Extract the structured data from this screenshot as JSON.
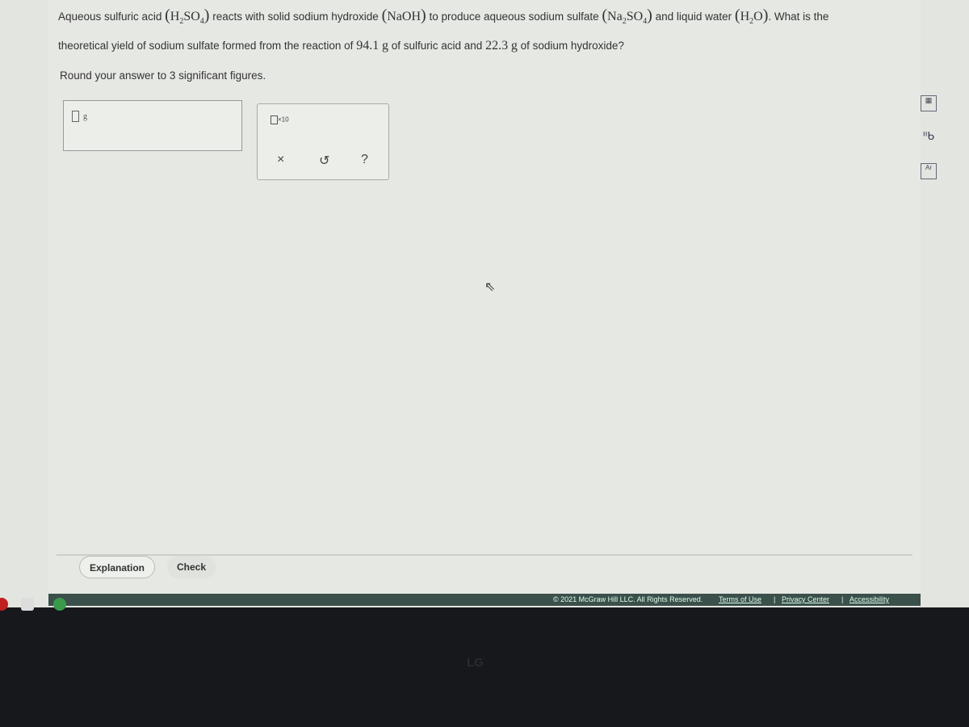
{
  "question": {
    "line1_a": "Aqueous sulfuric acid",
    "h2so4": "H₂SO₄",
    "line1_b": "reacts with solid sodium hydroxide",
    "naoh": "NaOH",
    "line1_c": "to produce aqueous sodium sulfate",
    "na2so4": "Na₂SO₄",
    "line1_d": "and liquid water",
    "h2o": "H₂O",
    "line1_e": ". What is the",
    "line2_a": "theoretical yield of sodium sulfate formed from the reaction of",
    "mass1": "94.1",
    "unit1": "g",
    "line2_b": "of sulfuric acid and",
    "mass2": "22.3",
    "unit2": "g",
    "line2_c": "of sodium hydroxide?",
    "instruction": "Round your answer to 3 significant figures."
  },
  "answer": {
    "value": "",
    "unit": "g"
  },
  "palette": {
    "sci_notation": "×10",
    "clear": "×",
    "undo": "↺",
    "help": "?"
  },
  "buttons": {
    "explanation": "Explanation",
    "check": "Check"
  },
  "footer": {
    "copyright": "© 2021 McGraw Hill LLC. All Rights Reserved.",
    "terms": "Terms of Use",
    "privacy": "Privacy Center",
    "accessibility": "Accessibility"
  },
  "monitor_brand": "LG",
  "tools": [
    "calculator-icon",
    "data-icon",
    "periodic-table-icon"
  ]
}
